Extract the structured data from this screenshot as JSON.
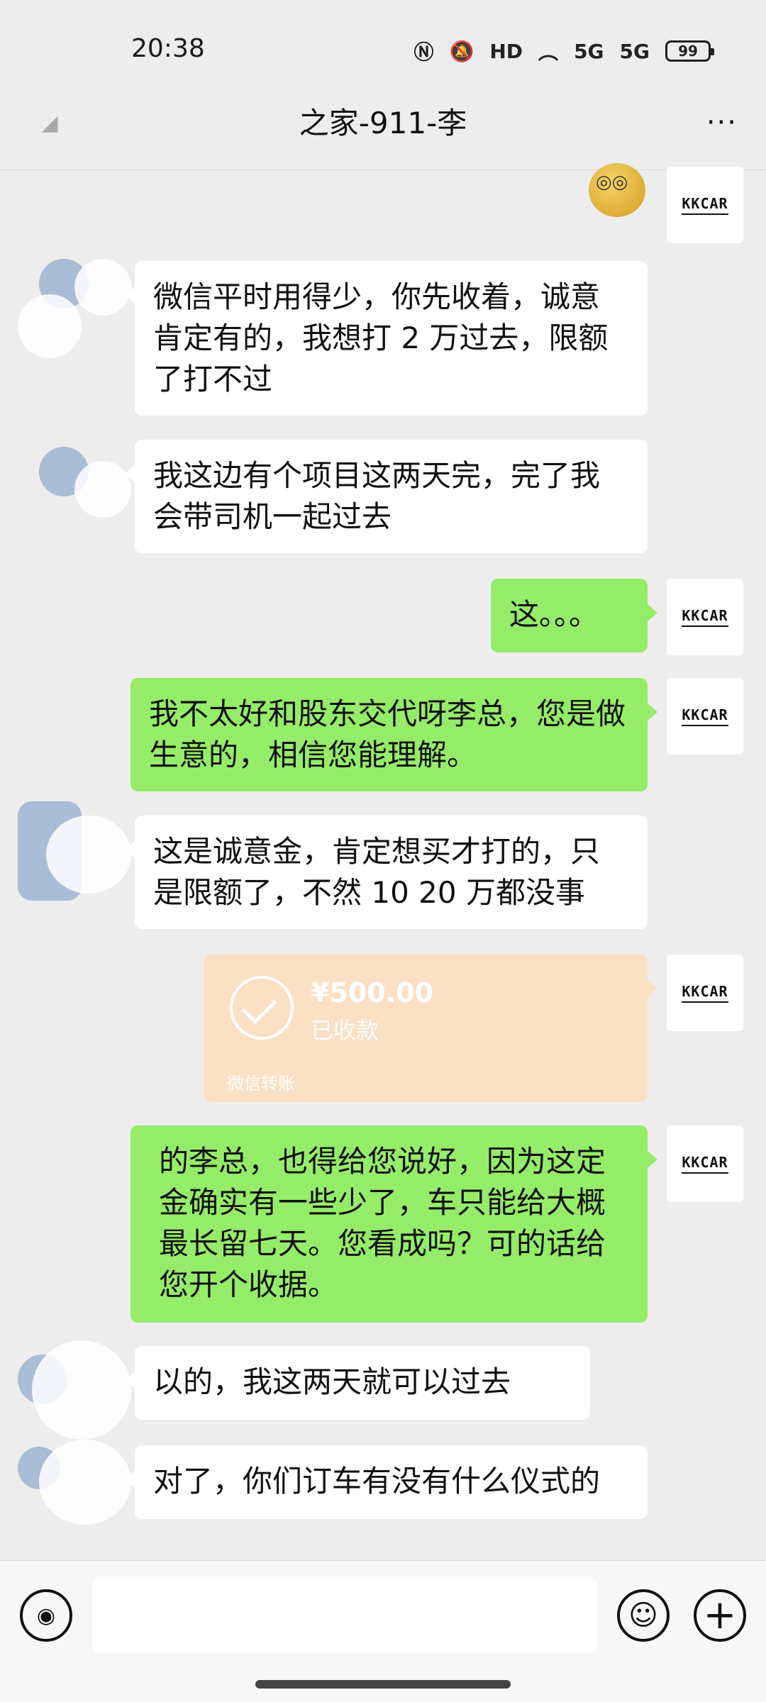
{
  "status_bar": {
    "time": "20:38",
    "icons": [
      "nfc-icon",
      "mute-icon",
      "hd-icon",
      "wifi-icon",
      "signal-5g-icon",
      "signal-5g-icon"
    ],
    "signal_labels": [
      "5G",
      "5G"
    ],
    "hd_label": "HD",
    "battery": "99"
  },
  "header": {
    "title": "之家-911-李",
    "more": "···"
  },
  "avatars": {
    "right_label": "KKCAR"
  },
  "messages": [
    {
      "side": "left",
      "text": "微信平时用得少，你先收着，诚意肯定有的，我想打 2 万过去，限额了打不过"
    },
    {
      "side": "left",
      "text": "我这边有个项目这两天完，完了我会带司机一起过去"
    },
    {
      "side": "right",
      "text": "这。。。"
    },
    {
      "side": "right",
      "text": "我不太好和股东交代呀李总，您是做生意的，相信您能理解。"
    },
    {
      "side": "left",
      "text": "这是诚意金，肯定想买才打的，只是限额了，不然 10 20 万都没事"
    },
    {
      "side": "right",
      "text": "的李总，也得给您说好，因为这定金确实有一些少了，车只能给大概最长留七天。您看成吗？可的话给您开个收据。"
    },
    {
      "side": "left",
      "text": "以的，我这两天就可以过去"
    },
    {
      "side": "left",
      "text": "对了，你们订车有没有什么仪式的"
    }
  ],
  "transfer": {
    "amount": "¥500.00",
    "status": "已收款",
    "label": "微信转账"
  },
  "input": {
    "placeholder": ""
  }
}
